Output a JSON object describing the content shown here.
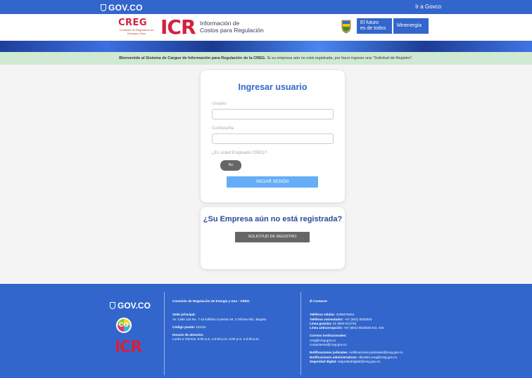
{
  "govbar": {
    "logo": "GOV.CO",
    "link": "Ir a Govco"
  },
  "header": {
    "creg_word": "CREG",
    "creg_sub": "Comisión de Regulación de Energía y Gas",
    "icr": "ICR",
    "title_line1": "Información de",
    "title_line2": "Costos para Regulación",
    "futuro_line1": "El futuro",
    "futuro_line2": "es de todos",
    "ministry": "Minenergía"
  },
  "notice": {
    "bold": "Bienvenido al Sistema de Cargue de Información para Regulación de la CREG.",
    "rest": " Si su empresa aún no está registrada, por favor ingrese una \"Solicitud de Registro\"."
  },
  "login": {
    "title": "Ingresar usuario",
    "user_label": "Usuario",
    "user_value": "",
    "password_label": "Contraseña",
    "password_value": "",
    "employee_question": "¿Es usted Empleado CREG?",
    "toggle_label": "No",
    "submit": "INICIAR SESIÓN"
  },
  "register": {
    "title": "¿Su Empresa aún no está registrada?",
    "button": "SOLICITUD DE REGISTRO"
  },
  "footer": {
    "logo": "GOV.CO",
    "badge": "CO",
    "icr": "ICR",
    "org": "Comisión de Regulación de Energía y Gas - CREG",
    "sede_label": "Sede principal:",
    "sede_value": "Av. Calle 116 No. 7-15 Edificio Cusezar Int. 2 Oficina 901, Bogotá",
    "postal_label": "Código postal:",
    "postal_value": "110111",
    "horario_label": "Horario de atención:",
    "horario_value": "Lunes a Viernes, 8:00 a.m. a 5:00 p.m. 2:00 p.m. a 5:00 p.m.",
    "contact_title": "Contacto",
    "cel_label": "Teléfono celular:",
    "cel_value": "3206475254",
    "conm_label": "Teléfono conmutador:",
    "conm_value": "+57 (601) 6032020",
    "gratis_label": "Línea gratuita:",
    "gratis_value": "01 8000 512734",
    "anti_label": "Línea anticorrupción:",
    "anti_value": "+57 (601) 6032020 Ext. 444",
    "correos_label": "Correos institucionales:",
    "correo1": "creg@creg.gov.co",
    "correo2": "contactenos@creg.gov.co",
    "notif_jud_label": "Notificaciones judiciales:",
    "notif_jud_value": "notificaciones.judiciales@creg.gov.co",
    "notif_adm_label": "Notificaciones administrativas:",
    "notif_adm_value": "oficiales.creg@creg.gov.co",
    "seg_label": "Seguridad digital:",
    "seg_value": "seguridaddigital@creg.gov.co"
  },
  "colors": {
    "brand_blue": "#3366cc",
    "creg_red": "#d4213d",
    "notice_green": "#cfe9d2",
    "login_button": "#64aef8"
  }
}
